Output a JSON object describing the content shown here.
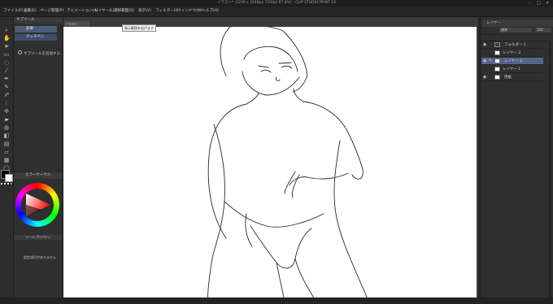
{
  "window": {
    "title": "イラスト* (3200 x 4248px 720dpi 87.8%) - CLIP STUDIO PAINT EX"
  },
  "menu": {
    "items": [
      "ファイル(F)",
      "編集(E)",
      "ページ管理(P)",
      "アニメーション(A)",
      "レイヤー(L)",
      "選択範囲(S)",
      "表示(V)",
      "フィルター(I)",
      "ウィンドウ(W)",
      "ヘルプ(H)"
    ]
  },
  "subtool": {
    "panel_title": "サブツール",
    "items": [
      "鉛筆",
      "タッチペン"
    ],
    "add_label": "サブツールを追加する"
  },
  "color_panel": {
    "title": "カラーサークル",
    "tool_property_title": "ツールプロパティ",
    "message": "設定項目がありません"
  },
  "canvas": {
    "tab_label": "イラスト",
    "tooltip": "表示範囲を広げます"
  },
  "layers": {
    "panel_title": "レイヤー",
    "blend_mode": "通常",
    "opacity": "100",
    "rows": [
      "フォルダー 1",
      "レイヤー 3",
      "レイヤー 2",
      "レイヤー 1",
      "用紙"
    ]
  },
  "colors": {
    "accent": "#56648a",
    "panel_bg": "#2f2f2f",
    "paper": "#ffffff"
  }
}
